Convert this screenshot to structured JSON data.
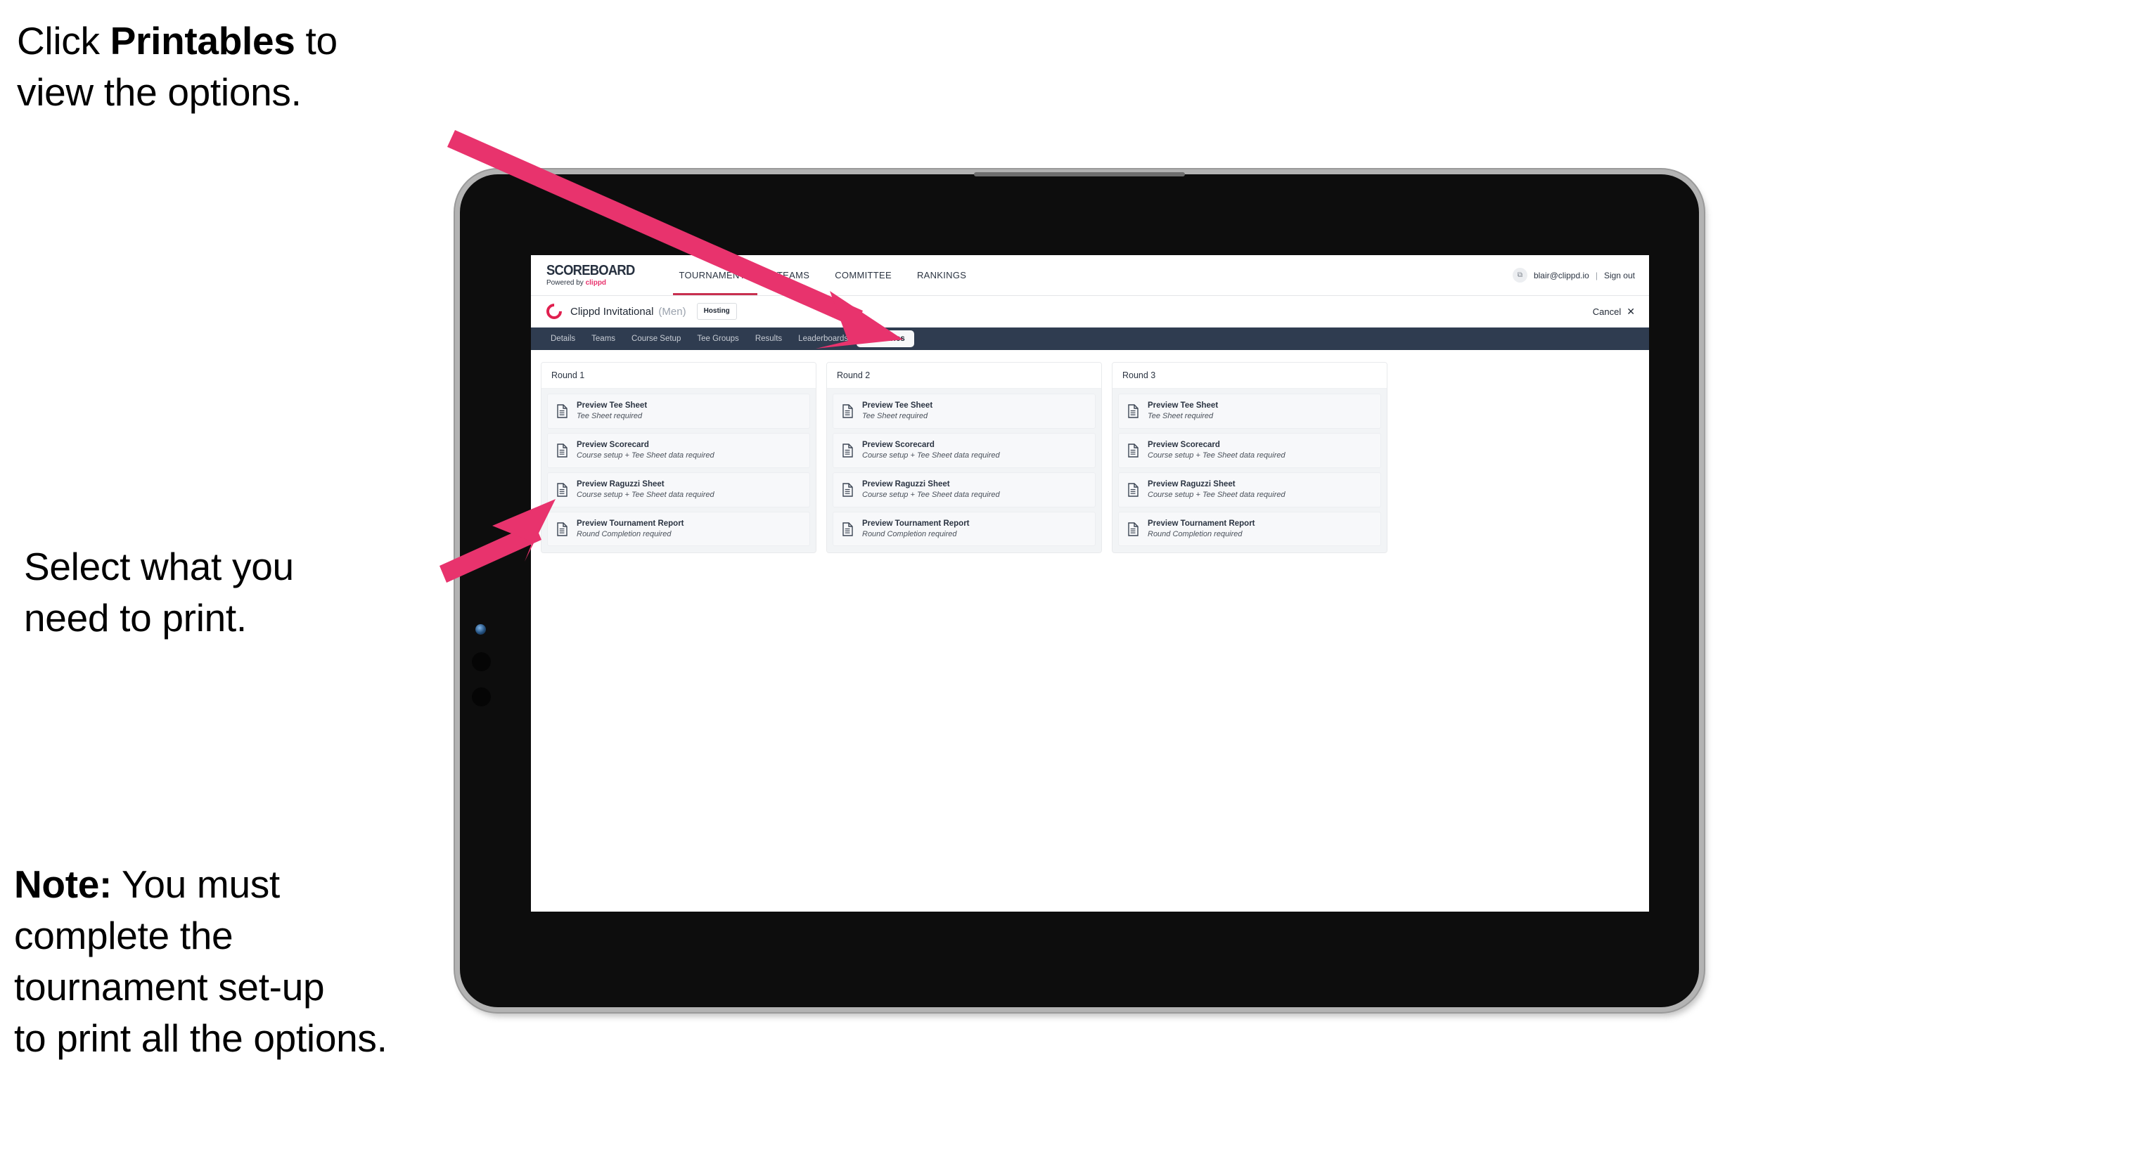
{
  "annotations": {
    "click_printables": {
      "prefix": "Click ",
      "bold": "Printables",
      "suffix": " to\nview the options."
    },
    "select_print": "Select what you\n need to print.",
    "note": {
      "bold": "Note:",
      "rest": " You must\ncomplete the\ntournament set-up\nto print all the options."
    }
  },
  "app": {
    "brand": {
      "title": "SCOREBOARD",
      "powered_prefix": "Powered by ",
      "powered_brand": "clippd"
    },
    "top_nav": [
      {
        "label": "TOURNAMENTS",
        "active": true
      },
      {
        "label": "TEAMS",
        "active": false
      },
      {
        "label": "COMMITTEE",
        "active": false
      },
      {
        "label": "RANKINGS",
        "active": false
      }
    ],
    "account": {
      "avatar_glyph": "⧉",
      "email": "blair@clippd.io",
      "separator": "|",
      "sign_out": "Sign out"
    },
    "tournament_bar": {
      "logo_name": "clippd-c-logo",
      "name": "Clippd Invitational",
      "gender": "(Men)",
      "badge": "Hosting",
      "cancel_label": "Cancel",
      "cancel_icon": "✕"
    },
    "tabs": [
      {
        "label": "Details",
        "active": false
      },
      {
        "label": "Teams",
        "active": false
      },
      {
        "label": "Course Setup",
        "active": false
      },
      {
        "label": "Tee Groups",
        "active": false
      },
      {
        "label": "Results",
        "active": false
      },
      {
        "label": "Leaderboards",
        "active": false
      },
      {
        "label": "Printables",
        "active": true
      }
    ],
    "rounds": [
      {
        "header": "Round 1",
        "items": [
          {
            "title": "Preview Tee Sheet",
            "subtitle": "Tee Sheet required"
          },
          {
            "title": "Preview Scorecard",
            "subtitle": "Course setup + Tee Sheet data required"
          },
          {
            "title": "Preview Raguzzi Sheet",
            "subtitle": "Course setup + Tee Sheet data required"
          },
          {
            "title": "Preview Tournament Report",
            "subtitle": "Round Completion required"
          }
        ]
      },
      {
        "header": "Round 2",
        "items": [
          {
            "title": "Preview Tee Sheet",
            "subtitle": "Tee Sheet required"
          },
          {
            "title": "Preview Scorecard",
            "subtitle": "Course setup + Tee Sheet data required"
          },
          {
            "title": "Preview Raguzzi Sheet",
            "subtitle": "Course setup + Tee Sheet data required"
          },
          {
            "title": "Preview Tournament Report",
            "subtitle": "Round Completion required"
          }
        ]
      },
      {
        "header": "Round 3",
        "items": [
          {
            "title": "Preview Tee Sheet",
            "subtitle": "Tee Sheet required"
          },
          {
            "title": "Preview Scorecard",
            "subtitle": "Course setup + Tee Sheet data required"
          },
          {
            "title": "Preview Raguzzi Sheet",
            "subtitle": "Course setup + Tee Sheet data required"
          },
          {
            "title": "Preview Tournament Report",
            "subtitle": "Round Completion required"
          }
        ]
      }
    ]
  },
  "colors": {
    "accent_pink": "#e8336d",
    "arrow_pink": "#e8336d",
    "tabstrip_dark": "#2f3c50",
    "nav_underline": "#c8304f",
    "clippd_red": "#e0204f"
  }
}
